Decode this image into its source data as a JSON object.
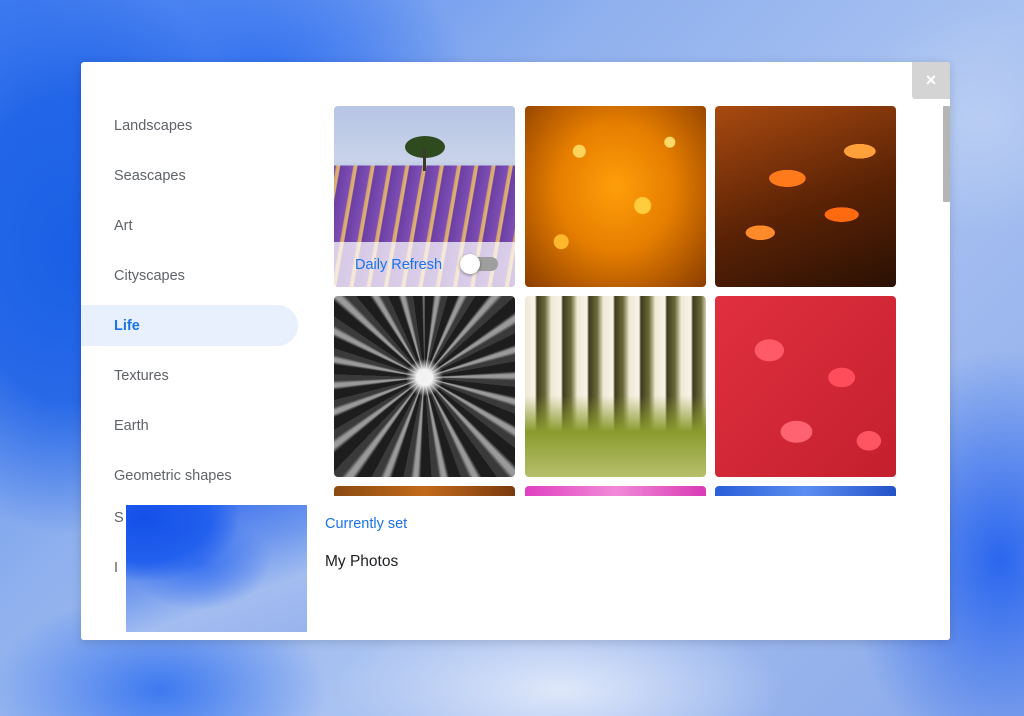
{
  "dialog": {
    "close_label": "×"
  },
  "sidebar": {
    "items": [
      {
        "label": "Landscapes",
        "active": false
      },
      {
        "label": "Seascapes",
        "active": false
      },
      {
        "label": "Art",
        "active": false
      },
      {
        "label": "Cityscapes",
        "active": false
      },
      {
        "label": "Life",
        "active": true
      },
      {
        "label": "Textures",
        "active": false
      },
      {
        "label": "Earth",
        "active": false
      },
      {
        "label": "Geometric shapes",
        "active": false
      }
    ],
    "partially_hidden": [
      "S",
      "I"
    ]
  },
  "grid": {
    "first_tile": {
      "daily_refresh_label": "Daily Refresh",
      "daily_refresh_enabled": false
    }
  },
  "current": {
    "label": "Currently set",
    "value": "My Photos"
  },
  "colors": {
    "accent": "#1a73e8",
    "active_bg": "#e8f0fe",
    "text_muted": "#5f6368"
  }
}
